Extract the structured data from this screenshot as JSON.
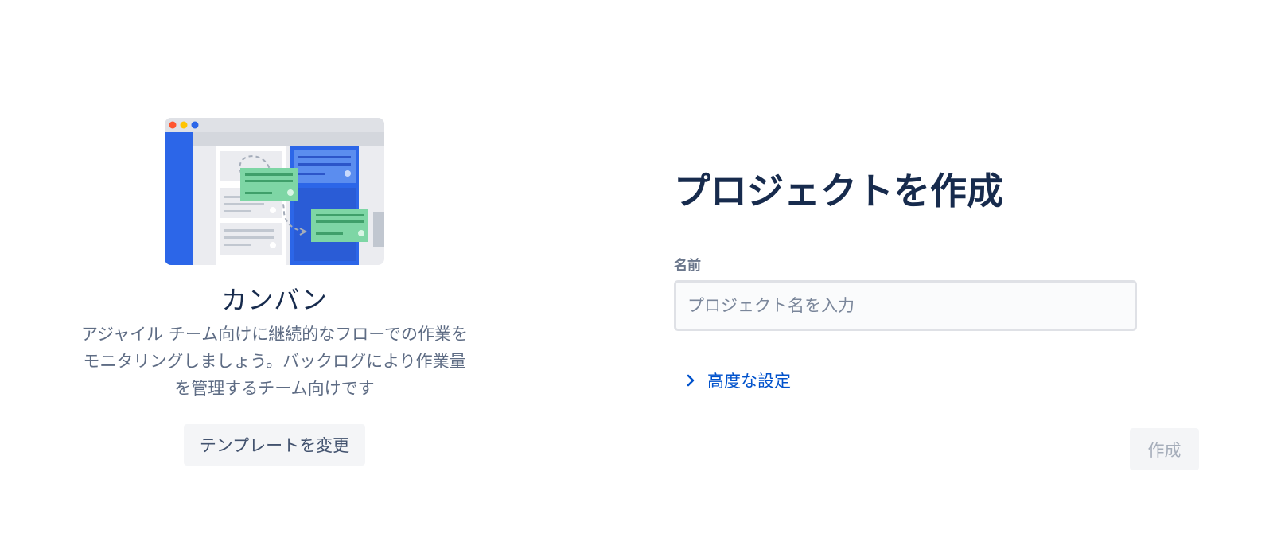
{
  "template": {
    "name": "カンバン",
    "description": "アジャイル チーム向けに継続的なフローでの作業をモニタリングしましょう。バックログにより作業量を管理するチーム向けです",
    "change_button_label": "テンプレートを変更",
    "illustration_icon": "kanban-board-illustration"
  },
  "form": {
    "title": "プロジェクトを作成",
    "name_label": "名前",
    "name_value": "",
    "name_placeholder": "プロジェクト名を入力",
    "advanced_label": "高度な設定",
    "advanced_icon": "chevron-right-icon",
    "create_button_label": "作成"
  },
  "colors": {
    "primary_text": "#172b4d",
    "secondary_text": "#5e6c84",
    "link": "#0052cc",
    "disabled_text": "#a5adba",
    "button_bg": "#f4f5f7",
    "illustration_blue": "#2c66e8",
    "illustration_green": "#7ed6a5"
  }
}
